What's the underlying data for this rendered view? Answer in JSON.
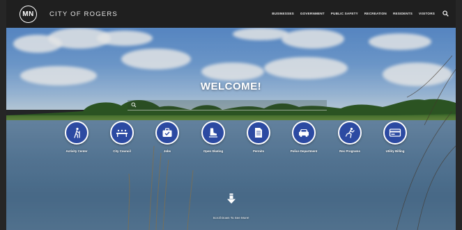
{
  "header": {
    "logo_text": "MN",
    "site_title": "CITY OF ROGERS",
    "nav": [
      "BUSINESSES",
      "GOVERNMENT",
      "PUBLIC SAFETY",
      "RECREATION",
      "RESIDENTS",
      "VISITORS"
    ],
    "search_icon": "search-icon"
  },
  "hero": {
    "heading": "WELCOME!",
    "search_placeholder": "",
    "quick_links": [
      {
        "label": "Activity Center",
        "icon": "hiker-icon"
      },
      {
        "label": "City Council",
        "icon": "council-bench-icon"
      },
      {
        "label": "Jobs",
        "icon": "briefcase-check-icon"
      },
      {
        "label": "Open Skating",
        "icon": "skate-icon"
      },
      {
        "label": "Permits",
        "icon": "document-icon"
      },
      {
        "label": "Police Department",
        "icon": "police-car-icon"
      },
      {
        "label": "Rec Programs",
        "icon": "runner-icon"
      },
      {
        "label": "Utility Billing",
        "icon": "credit-card-icon"
      }
    ],
    "scroll_text": "Scroll Down To See More!"
  },
  "colors": {
    "header_bg": "#1f1f1f",
    "icon_circle": "#2c4aa2",
    "text": "#ffffff"
  }
}
